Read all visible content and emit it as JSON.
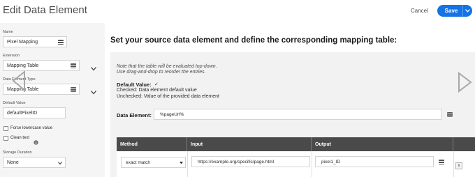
{
  "header": {
    "title": "Edit Data Element",
    "cancel_label": "Cancel",
    "save_label": "Save",
    "accent": "#1473e6"
  },
  "left_panel": {
    "name_label": "Name",
    "name_value": "Pixel Mapping",
    "extension_label": "Extension",
    "extension_value": "Mapping Table",
    "type_label": "Data Element Type",
    "type_value": "Mapping Table",
    "default_value_label": "Default Value",
    "default_value": "defaultPixelID",
    "force_lowercase_label": "Force lowercase value",
    "clean_text_label": "Clean text",
    "storage_duration_label": "Storage Duration",
    "storage_duration_value": "None"
  },
  "main": {
    "heading": "Set your source data element and define the corresponding mapping table:",
    "note_line1": "Note that the table will be evaluated top-down.",
    "note_line2": "Use drag-and-drop to reorder the entries.",
    "default_value_title": "Default Value:",
    "default_value_checkmark": "✓",
    "checked_text": "Checked: Data element default value",
    "unchecked_text": "Unchecked: Value of the provided data element",
    "data_element_label": "Data Element:",
    "data_element_value": "%pageUrl%",
    "table": {
      "columns": [
        "Method",
        "Input",
        "Output"
      ],
      "rows": [
        {
          "method": "exact match",
          "input": "https://example.org/specific/page.html",
          "output": "pixel1_ID",
          "remove": "x"
        }
      ]
    }
  }
}
